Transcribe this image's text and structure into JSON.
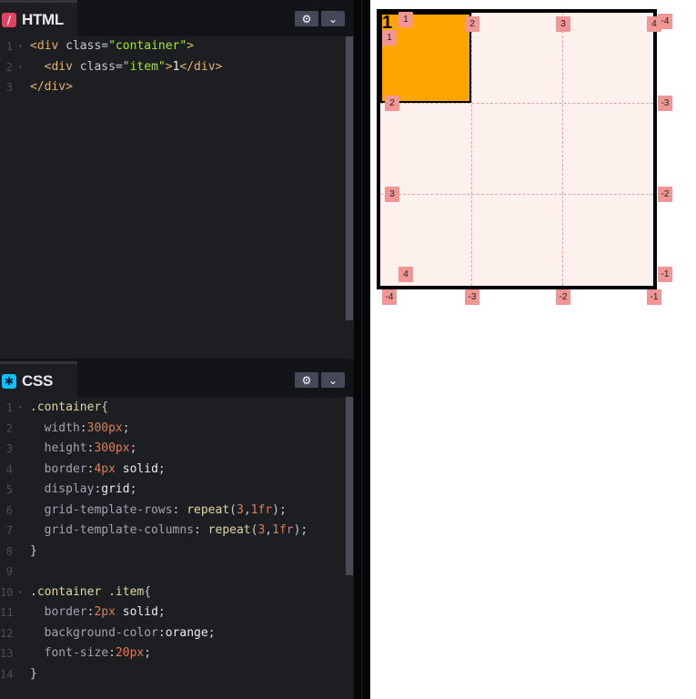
{
  "html_panel": {
    "tab_label": "HTML",
    "icon": "slash-icon",
    "lines": [
      {
        "n": "1",
        "fold": "▾",
        "parts": [
          [
            "tag",
            "<div "
          ],
          [
            "attr",
            "class"
          ],
          [
            "pun",
            "="
          ],
          [
            "str",
            "\"container\""
          ],
          [
            "tag",
            ">"
          ]
        ]
      },
      {
        "n": "2",
        "fold": "▾",
        "parts": [
          [
            "tag",
            "  <div "
          ],
          [
            "attr",
            "class"
          ],
          [
            "pun",
            "="
          ],
          [
            "str",
            "\"item\""
          ],
          [
            "tag",
            ">"
          ],
          [
            "kw",
            "1"
          ],
          [
            "tag",
            "</div>"
          ]
        ]
      },
      {
        "n": "3",
        "fold": "",
        "parts": [
          [
            "tag",
            "</div>"
          ]
        ]
      }
    ]
  },
  "css_panel": {
    "tab_label": "CSS",
    "icon": "asterisk-icon",
    "lines": [
      {
        "n": "1",
        "fold": "▾",
        "parts": [
          [
            "sel",
            ".container"
          ],
          [
            "pun",
            "{"
          ]
        ]
      },
      {
        "n": "2",
        "fold": "",
        "parts": [
          [
            "prop",
            "  width"
          ],
          [
            "pun",
            ":"
          ],
          [
            "num",
            "300px"
          ],
          [
            "pun",
            ";"
          ]
        ]
      },
      {
        "n": "3",
        "fold": "",
        "parts": [
          [
            "prop",
            "  height"
          ],
          [
            "pun",
            ":"
          ],
          [
            "num",
            "300px"
          ],
          [
            "pun",
            ";"
          ]
        ]
      },
      {
        "n": "4",
        "fold": "",
        "parts": [
          [
            "prop",
            "  border"
          ],
          [
            "pun",
            ":"
          ],
          [
            "num",
            "4px"
          ],
          [
            "kw",
            " solid"
          ],
          [
            "pun",
            ";"
          ]
        ]
      },
      {
        "n": "5",
        "fold": "",
        "parts": [
          [
            "prop",
            "  display"
          ],
          [
            "pun",
            ":"
          ],
          [
            "kw",
            "grid"
          ],
          [
            "pun",
            ";"
          ]
        ]
      },
      {
        "n": "6",
        "fold": "",
        "parts": [
          [
            "prop",
            "  grid-template-rows"
          ],
          [
            "pun",
            ": "
          ],
          [
            "fn",
            "repeat"
          ],
          [
            "pun",
            "("
          ],
          [
            "num",
            "3"
          ],
          [
            "pun",
            ","
          ],
          [
            "num",
            "1fr"
          ],
          [
            "pun",
            ");"
          ]
        ]
      },
      {
        "n": "7",
        "fold": "",
        "parts": [
          [
            "prop",
            "  grid-template-columns"
          ],
          [
            "pun",
            ": "
          ],
          [
            "fn",
            "repeat"
          ],
          [
            "pun",
            "("
          ],
          [
            "num",
            "3"
          ],
          [
            "pun",
            ","
          ],
          [
            "num",
            "1fr"
          ],
          [
            "pun",
            ");"
          ]
        ]
      },
      {
        "n": "8",
        "fold": "",
        "parts": [
          [
            "pun",
            "}"
          ]
        ]
      },
      {
        "n": "9",
        "fold": "",
        "parts": []
      },
      {
        "n": "10",
        "fold": "▾",
        "parts": [
          [
            "sel",
            ".container .item"
          ],
          [
            "pun",
            "{"
          ]
        ]
      },
      {
        "n": "11",
        "fold": "",
        "parts": [
          [
            "prop",
            "  border"
          ],
          [
            "pun",
            ":"
          ],
          [
            "num",
            "2px"
          ],
          [
            "kw",
            " solid"
          ],
          [
            "pun",
            ";"
          ]
        ]
      },
      {
        "n": "12",
        "fold": "",
        "parts": [
          [
            "prop",
            "  background-color"
          ],
          [
            "pun",
            ":"
          ],
          [
            "kw",
            "orange"
          ],
          [
            "pun",
            ";"
          ]
        ]
      },
      {
        "n": "13",
        "fold": "",
        "parts": [
          [
            "prop",
            "  font-size"
          ],
          [
            "pun",
            ":"
          ],
          [
            "num",
            "20px"
          ],
          [
            "pun",
            ";"
          ]
        ]
      },
      {
        "n": "14",
        "fold": "",
        "parts": [
          [
            "pun",
            "}"
          ]
        ]
      }
    ]
  },
  "toolbar": {
    "settings_icon": "gear-icon",
    "collapse_icon": "chevron-down-icon"
  },
  "preview": {
    "item_text": "1",
    "container_border_color": "#000000",
    "item_background": "#FFA500",
    "grid_line_color": "#d9a7a7",
    "badge_color": "#f19595",
    "badges": [
      {
        "name": "col-line-1-top",
        "text": "1"
      },
      {
        "name": "col-line-2-top",
        "text": "2"
      },
      {
        "name": "col-line-3-top",
        "text": "3"
      },
      {
        "name": "col-line-4-top",
        "text": "4"
      },
      {
        "name": "col-line-neg4-right",
        "text": "-4"
      },
      {
        "name": "row-line-1-left",
        "text": "1"
      },
      {
        "name": "row-line-2-left",
        "text": "2"
      },
      {
        "name": "row-line-3-left",
        "text": "3"
      },
      {
        "name": "row-line-4-left",
        "text": "4"
      },
      {
        "name": "row-line-neg3-right",
        "text": "-3"
      },
      {
        "name": "row-line-neg2-right",
        "text": "-2"
      },
      {
        "name": "row-line-neg1-right",
        "text": "-1"
      },
      {
        "name": "col-line-neg4-bottom",
        "text": "-4"
      },
      {
        "name": "col-line-neg3-bottom",
        "text": "-3"
      },
      {
        "name": "col-line-neg2-bottom",
        "text": "-2"
      },
      {
        "name": "col-line-neg1-bottom",
        "text": "-1"
      }
    ]
  }
}
